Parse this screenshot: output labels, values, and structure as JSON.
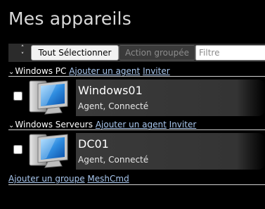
{
  "page": {
    "title": "Mes appareils"
  },
  "toolbar": {
    "select_all_label": "Tout Sélectionner",
    "group_action_label": "Action groupée",
    "filter_placeholder": "Filtre"
  },
  "groups": [
    {
      "name": "Windows PC",
      "add_agent_label": "Ajouter un agent",
      "invite_label": "Inviter",
      "devices": [
        {
          "name": "Windows01",
          "status": "Agent, Connecté",
          "icon": "desktop-computer-icon"
        }
      ]
    },
    {
      "name": "Windows Serveurs",
      "add_agent_label": "Ajouter un agent",
      "invite_label": "Inviter",
      "devices": [
        {
          "name": "DC01",
          "status": "Agent, Connecté",
          "icon": "desktop-computer-icon"
        }
      ]
    }
  ],
  "footer": {
    "add_group_label": "Ajouter un groupe",
    "meshcmd_label": "MeshCmd"
  },
  "colors": {
    "background": "#000000",
    "link": "#a9c7ee",
    "card": "#3a3a3a"
  }
}
